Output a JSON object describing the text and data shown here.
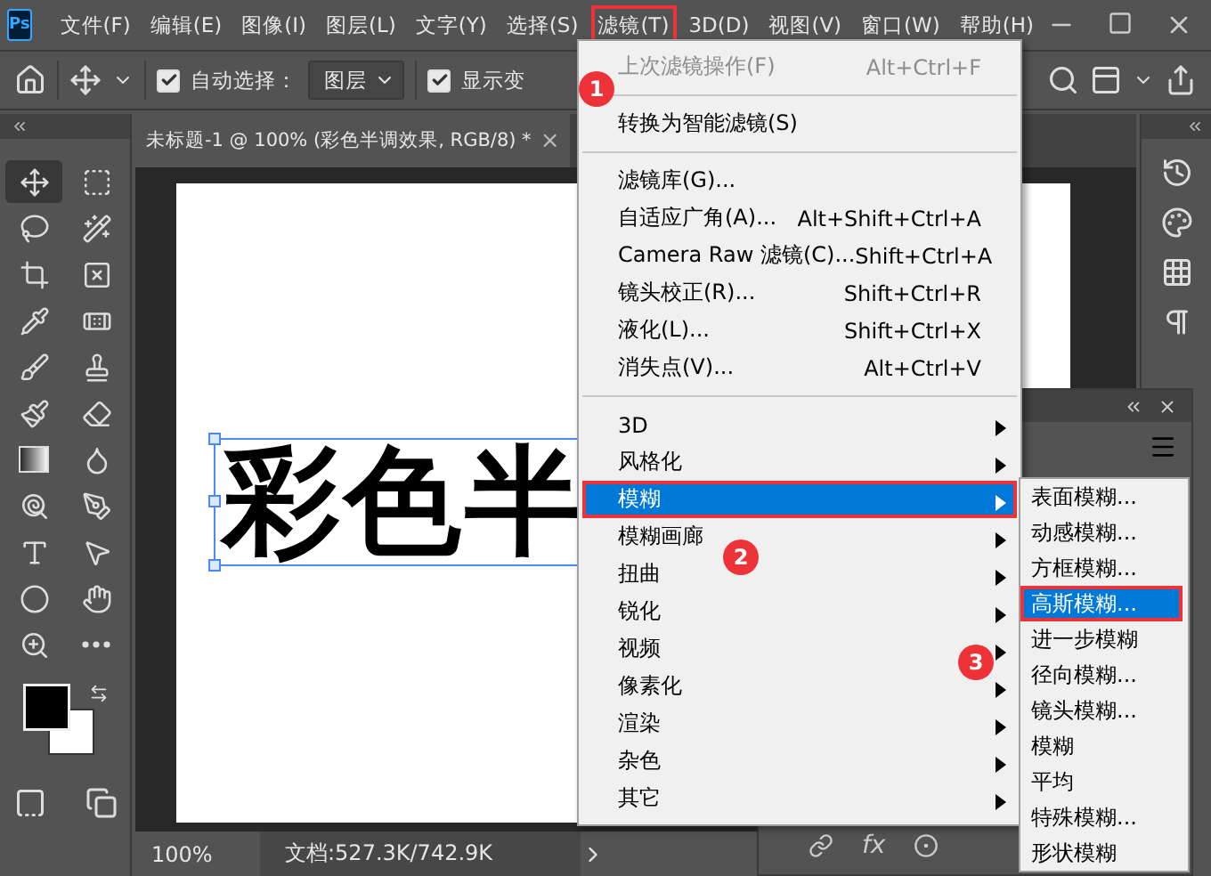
{
  "app_logo": "Ps",
  "menubar": [
    {
      "label": "文件(F)",
      "annotated": false
    },
    {
      "label": "编辑(E)",
      "annotated": false
    },
    {
      "label": "图像(I)",
      "annotated": false
    },
    {
      "label": "图层(L)",
      "annotated": false
    },
    {
      "label": "文字(Y)",
      "annotated": false
    },
    {
      "label": "选择(S)",
      "annotated": false
    },
    {
      "label": "滤镜(T)",
      "annotated": true,
      "badge": "1"
    },
    {
      "label": "3D(D)",
      "annotated": false
    },
    {
      "label": "视图(V)",
      "annotated": false
    },
    {
      "label": "窗口(W)",
      "annotated": false
    },
    {
      "label": "帮助(H)",
      "annotated": false
    }
  ],
  "options_bar": {
    "auto_select": {
      "label": "自动选择：",
      "checked": true
    },
    "layer_select": {
      "value": "图层"
    },
    "show_transform": {
      "label": "显示变",
      "checked": true
    }
  },
  "tools": [
    {
      "kind": "move",
      "selected": true
    },
    {
      "kind": "marquee",
      "selected": false
    },
    {
      "kind": "lasso",
      "selected": false
    },
    {
      "kind": "quick-select",
      "selected": false
    },
    {
      "kind": "crop",
      "selected": false
    },
    {
      "kind": "frame",
      "selected": false
    },
    {
      "kind": "eyedropper",
      "selected": false
    },
    {
      "kind": "healing",
      "selected": false
    },
    {
      "kind": "brush",
      "selected": false
    },
    {
      "kind": "stamp",
      "selected": false
    },
    {
      "kind": "history-brush",
      "selected": false
    },
    {
      "kind": "eraser",
      "selected": false
    },
    {
      "kind": "gradient",
      "selected": false
    },
    {
      "kind": "blur",
      "selected": false
    },
    {
      "kind": "dodge",
      "selected": false
    },
    {
      "kind": "pen",
      "selected": false
    },
    {
      "kind": "type",
      "selected": false
    },
    {
      "kind": "path-select",
      "selected": false
    },
    {
      "kind": "ellipse",
      "selected": false
    },
    {
      "kind": "hand",
      "selected": false
    },
    {
      "kind": "zoom",
      "selected": false
    },
    {
      "kind": "more",
      "selected": false
    }
  ],
  "document": {
    "tab_title": "未标题-1 @ 100% (彩色半调效果, RGB/8) *",
    "tab_close": "×",
    "canvas_text": "彩色半"
  },
  "status_bar": {
    "zoom": "100%",
    "doc_size": "文档:527.3K/742.9K"
  },
  "panel": {
    "fx": "fx"
  },
  "filter_menu": [
    {
      "kind": "command",
      "label": "上次滤镜操作(F)",
      "shortcut": "Alt+Ctrl+F",
      "disabled": true,
      "selected": false,
      "annotated": false
    },
    {
      "kind": "separator"
    },
    {
      "kind": "command",
      "label": "转换为智能滤镜(S)",
      "disabled": false,
      "selected": false,
      "annotated": false
    },
    {
      "kind": "separator"
    },
    {
      "kind": "command",
      "label": "滤镜库(G)...",
      "disabled": false,
      "selected": false,
      "annotated": false
    },
    {
      "kind": "command",
      "label": "自适应广角(A)...",
      "shortcut": "Alt+Shift+Ctrl+A",
      "disabled": false,
      "selected": false,
      "annotated": false
    },
    {
      "kind": "command",
      "label": "Camera Raw 滤镜(C)...",
      "shortcut": "Shift+Ctrl+A",
      "disabled": false,
      "selected": false,
      "annotated": false
    },
    {
      "kind": "command",
      "label": "镜头校正(R)...",
      "shortcut": "Shift+Ctrl+R",
      "disabled": false,
      "selected": false,
      "annotated": false
    },
    {
      "kind": "command",
      "label": "液化(L)...",
      "shortcut": "Shift+Ctrl+X",
      "disabled": false,
      "selected": false,
      "annotated": false
    },
    {
      "kind": "command",
      "label": "消失点(V)...",
      "shortcut": "Alt+Ctrl+V",
      "disabled": false,
      "selected": false,
      "annotated": false
    },
    {
      "kind": "separator"
    },
    {
      "kind": "submenu",
      "label": "3D",
      "disabled": false,
      "selected": false,
      "annotated": false
    },
    {
      "kind": "submenu",
      "label": "风格化",
      "disabled": false,
      "selected": false,
      "annotated": false
    },
    {
      "kind": "submenu",
      "label": "模糊",
      "disabled": false,
      "selected": true,
      "annotated": true,
      "badge": "2"
    },
    {
      "kind": "submenu",
      "label": "模糊画廊",
      "disabled": false,
      "selected": false,
      "annotated": false
    },
    {
      "kind": "submenu",
      "label": "扭曲",
      "disabled": false,
      "selected": false,
      "annotated": false
    },
    {
      "kind": "submenu",
      "label": "锐化",
      "disabled": false,
      "selected": false,
      "annotated": false
    },
    {
      "kind": "submenu",
      "label": "视频",
      "disabled": false,
      "selected": false,
      "annotated": false
    },
    {
      "kind": "submenu",
      "label": "像素化",
      "disabled": false,
      "selected": false,
      "annotated": false
    },
    {
      "kind": "submenu",
      "label": "渲染",
      "disabled": false,
      "selected": false,
      "annotated": false
    },
    {
      "kind": "submenu",
      "label": "杂色",
      "disabled": false,
      "selected": false,
      "annotated": false
    },
    {
      "kind": "submenu",
      "label": "其它",
      "disabled": false,
      "selected": false,
      "annotated": false
    }
  ],
  "blur_submenu": [
    {
      "label": "表面模糊...",
      "selected": false,
      "annotated": false
    },
    {
      "label": "动感模糊...",
      "selected": false,
      "annotated": false
    },
    {
      "label": "方框模糊...",
      "selected": false,
      "annotated": false
    },
    {
      "label": "高斯模糊...",
      "selected": true,
      "annotated": true,
      "badge": "3"
    },
    {
      "label": "进一步模糊",
      "selected": false,
      "annotated": false
    },
    {
      "label": "径向模糊...",
      "selected": false,
      "annotated": false
    },
    {
      "label": "镜头模糊...",
      "selected": false,
      "annotated": false
    },
    {
      "label": "模糊",
      "selected": false,
      "annotated": false
    },
    {
      "label": "平均",
      "selected": false,
      "annotated": false
    },
    {
      "label": "特殊模糊...",
      "selected": false,
      "annotated": false
    },
    {
      "label": "形状模糊",
      "selected": false,
      "annotated": false
    }
  ]
}
